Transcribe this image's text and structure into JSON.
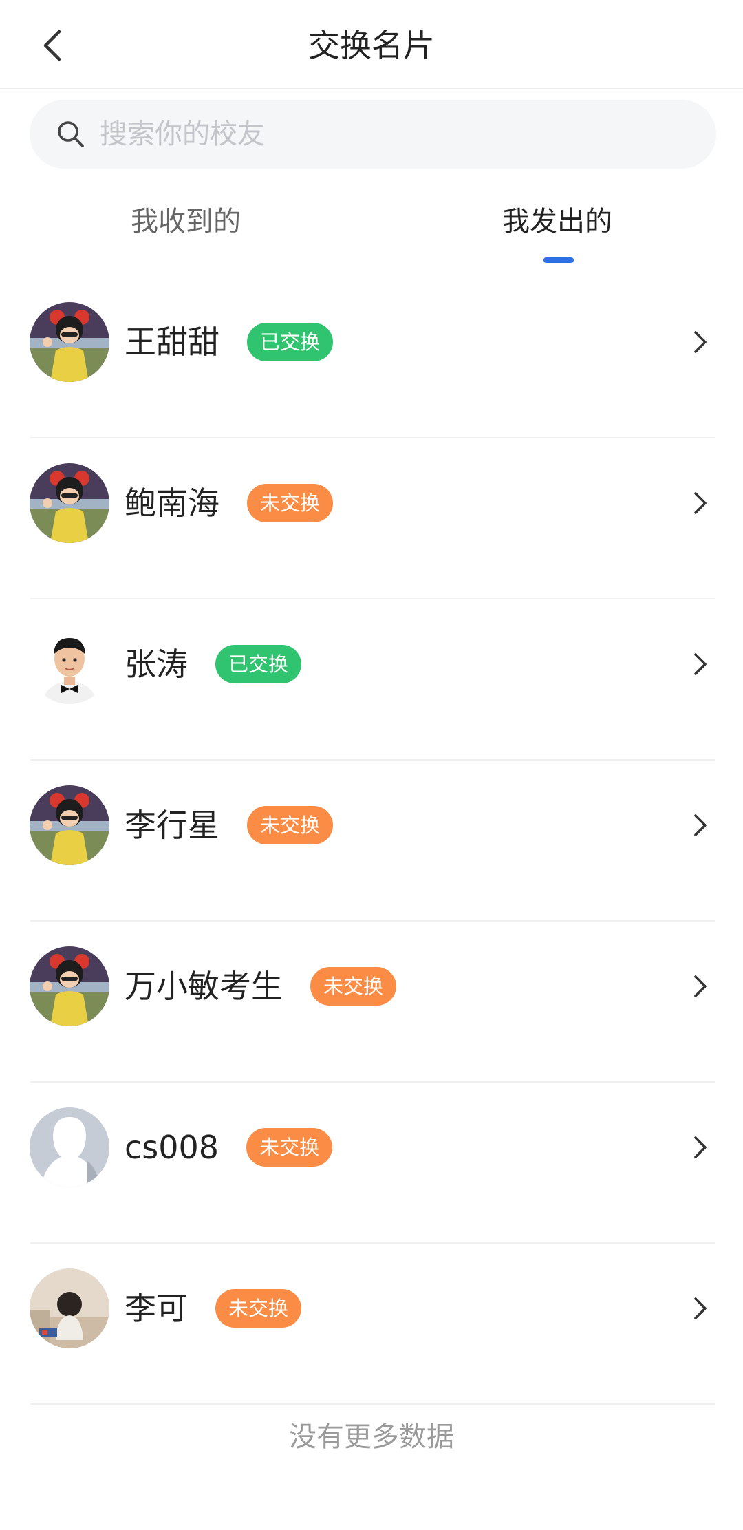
{
  "header": {
    "title": "交换名片",
    "back_icon": "chevron-left-icon"
  },
  "search": {
    "placeholder": "搜索你的校友",
    "value": "",
    "icon": "search-icon"
  },
  "tabs": [
    {
      "label": "我收到的",
      "active": false
    },
    {
      "label": "我发出的",
      "active": true
    }
  ],
  "colors": {
    "accent": "#2f6fe4",
    "exchanged": "#31c470",
    "not_exchanged": "#fa8c45"
  },
  "contacts": [
    {
      "name": "王甜甜",
      "status": "已交换",
      "exchanged": true,
      "avatar": "cartoon-girl-avatar"
    },
    {
      "name": "鲍南海",
      "status": "未交换",
      "exchanged": false,
      "avatar": "cartoon-girl-avatar"
    },
    {
      "name": "张涛",
      "status": "已交换",
      "exchanged": true,
      "avatar": "boy-photo-avatar"
    },
    {
      "name": "李行星",
      "status": "未交换",
      "exchanged": false,
      "avatar": "cartoon-girl-avatar"
    },
    {
      "name": "万小敏考生",
      "status": "未交换",
      "exchanged": false,
      "avatar": "cartoon-girl-avatar"
    },
    {
      "name": "cs008",
      "status": "未交换",
      "exchanged": false,
      "avatar": "default-person-avatar"
    },
    {
      "name": "李可",
      "status": "未交换",
      "exchanged": false,
      "avatar": "child-photo-avatar"
    }
  ],
  "footer": {
    "text": "没有更多数据"
  }
}
